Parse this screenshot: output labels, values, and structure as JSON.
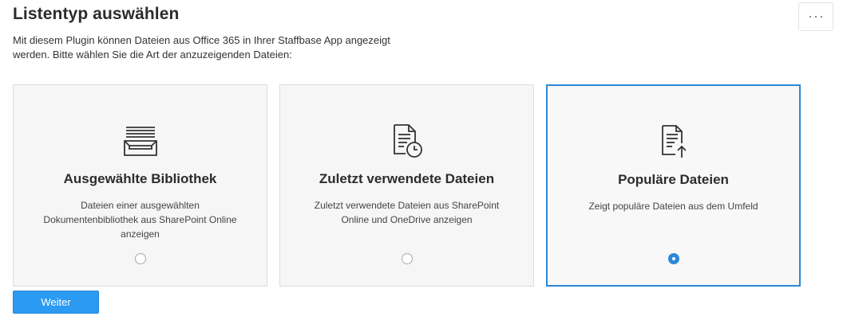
{
  "header": {
    "title": "Listentyp auswählen",
    "more_icon": "ellipsis-icon"
  },
  "description": "Mit diesem Plugin können Dateien aus Office 365 in Ihrer Staffbase App angezeigt werden. Bitte wählen Sie die Art der anzuzeigenden Dateien:",
  "options": [
    {
      "icon": "library-tray-icon",
      "title": "Ausgewählte Bibliothek",
      "description": "Dateien einer ausgewählten Dokumentenbibliothek aus SharePoint Online anzeigen",
      "selected": false
    },
    {
      "icon": "recent-document-clock-icon",
      "title": "Zuletzt verwendete Dateien",
      "description": "Zuletzt verwendete Dateien aus SharePoint Online und OneDrive anzeigen",
      "selected": false
    },
    {
      "icon": "popular-document-arrow-icon",
      "title": "Populäre Dateien",
      "description": "Zeigt populäre Dateien aus dem Umfeld",
      "selected": true
    }
  ],
  "actions": {
    "next_label": "Weiter"
  },
  "colors": {
    "accent": "#2b88d8",
    "button": "#2b9af3",
    "card_background": "#f6f6f6"
  }
}
